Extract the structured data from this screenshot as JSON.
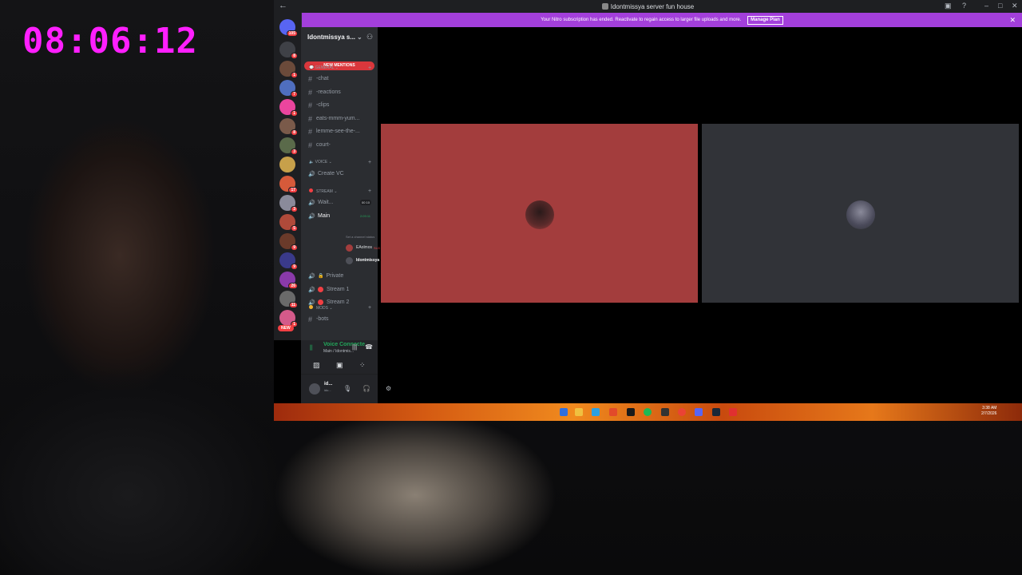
{
  "overlay": {
    "timer": "08:06:12"
  },
  "window": {
    "title": "Idontmissya server fun house"
  },
  "banner": {
    "message": "Your Nitro subscription has ended. Reactivate to regain access to larger file uploads and more.",
    "button": "Manage Plan"
  },
  "server": {
    "name": "Idontmissya s...",
    "new_mentions": "NEW MENTIONS"
  },
  "rail": {
    "badges": [
      "105",
      "8",
      "1",
      "7",
      "1",
      "8",
      "3",
      "",
      "17",
      "3",
      "5",
      "9",
      "9",
      "26",
      "11",
      "1"
    ],
    "new_label": "NEW",
    "colors": [
      "#5865f2",
      "#3f4147",
      "#6b4a3a",
      "#4f6ebf",
      "#eb459e",
      "#7a5a4a",
      "#5a6a4a",
      "#c7a04a",
      "#d65a3a",
      "#8a8a9a",
      "#b04a3a",
      "#6a3a2a",
      "#3a3a8a",
      "#8a3aaa",
      "#6a6a6a",
      "#d45a8a"
    ]
  },
  "categories": {
    "general": "GENERAL",
    "voice": "Voice",
    "stream": "Stream",
    "mods": "Mods"
  },
  "channels": {
    "chat": "-chat",
    "reactions": "-reactions",
    "clips": "-clips",
    "eats": "eats-mmm-yum...",
    "lemme": "lemme-see-the-...",
    "court": "court-",
    "create_vc": "Create VC",
    "waiting": "Wait...",
    "waiting_limit": "00 10",
    "main": "Main",
    "main_time": "2:09:11",
    "main_status": "Set a channel status",
    "private": "Private",
    "stream1": "Stream 1",
    "stream2": "Stream 2",
    "bots": "-bots"
  },
  "members": {
    "m1": "EAolmos",
    "m1_tag": "SLG",
    "m2": "Idontmissya"
  },
  "voice": {
    "status": "Voice Connecte",
    "channel": "Main / Idontmis..."
  },
  "user": {
    "name": "id...",
    "sub": "ido..."
  },
  "taskbar": {
    "time": "3:38 AM",
    "date": "2/7/2026"
  }
}
